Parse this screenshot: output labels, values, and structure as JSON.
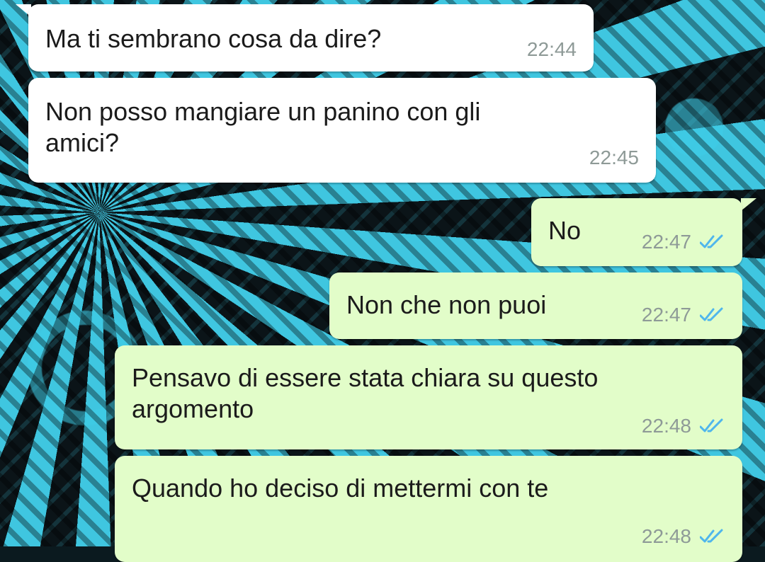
{
  "messages": [
    {
      "direction": "incoming",
      "text": "Ma ti sembrano cosa da dire?",
      "time": "22:44"
    },
    {
      "direction": "incoming",
      "text": "Non posso mangiare un panino con gli\namici?",
      "time": "22:45"
    },
    {
      "direction": "outgoing",
      "text": "No",
      "time": "22:47",
      "status": "read"
    },
    {
      "direction": "outgoing",
      "text": "Non che non puoi",
      "time": "22:47",
      "status": "read"
    },
    {
      "direction": "outgoing",
      "text": "Pensavo di essere stata chiara su questo\nargomento",
      "time": "22:48",
      "status": "read"
    },
    {
      "direction": "outgoing",
      "text": "Quando ho deciso di mettermi con te",
      "time": "22:48",
      "status": "read"
    }
  ],
  "colors": {
    "incoming_bubble": "#ffffff",
    "outgoing_bubble": "#e2fdc9",
    "read_ticks": "#4fb6ec",
    "timestamp": "#8e9a97",
    "wallpaper_accent": "#3fc6e0"
  },
  "icons": {
    "read_status": "double-check-icon"
  }
}
